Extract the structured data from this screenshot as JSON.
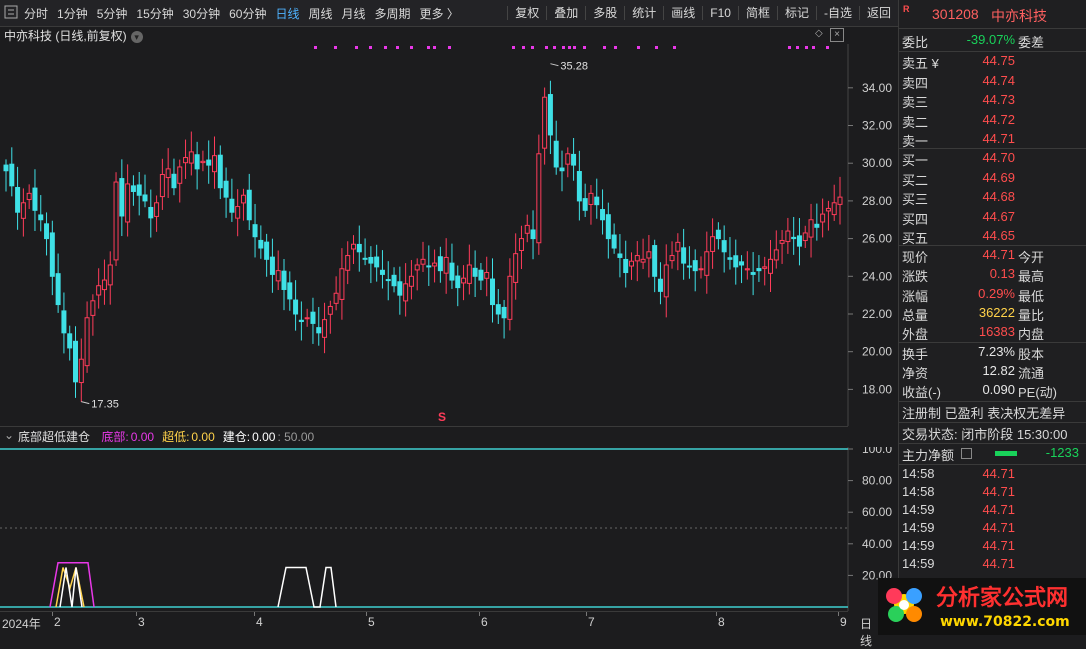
{
  "toolbar": {
    "period_tabs": [
      "分时",
      "1分钟",
      "5分钟",
      "15分钟",
      "30分钟",
      "60分钟",
      "日线",
      "周线",
      "月线",
      "多周期",
      "更多 〉"
    ],
    "active_tab": "日线",
    "tools": [
      "复权",
      "叠加",
      "多股",
      "统计",
      "画线",
      "F10",
      "简框",
      "标记",
      "-自选",
      "返回"
    ]
  },
  "chart": {
    "title": "中亦科技 (日线,前复权)",
    "high_label": "35.28",
    "low_label": "17.35",
    "signal_mark": "S",
    "price_ticks": [
      "34.00",
      "32.00",
      "30.00",
      "28.00",
      "26.00",
      "24.00",
      "22.00",
      "20.00",
      "18.00"
    ],
    "colors": {
      "up": "#ff3c5a",
      "down": "#3fe0e6",
      "magenta": "#e838e8"
    }
  },
  "indicator": {
    "name": "底部超低建仓",
    "items": [
      {
        "label": "底部:",
        "value": "0.00",
        "color": "#e838e8"
      },
      {
        "label": "超低:",
        "value": "0.00",
        "color": "#ffd24a"
      },
      {
        "label": "建仓:",
        "value": "0.00",
        "color": "#ffffff"
      }
    ],
    "ref_level": ": 50.00",
    "axis": [
      "100.0",
      "80.00",
      "60.00",
      "40.00",
      "20.00"
    ]
  },
  "xaxis": {
    "labels": [
      "2024年",
      "2",
      "3",
      "4",
      "5",
      "6",
      "7",
      "8",
      "9",
      "日线"
    ]
  },
  "quote": {
    "code": "301208",
    "name": "中亦科技",
    "wei_bi": {
      "label": "委比",
      "value": "-39.07%",
      "tail": "委差"
    },
    "asks": [
      {
        "label": "卖五 ¥",
        "price": "44.75"
      },
      {
        "label": "卖四",
        "price": "44.74"
      },
      {
        "label": "卖三",
        "price": "44.73"
      },
      {
        "label": "卖二",
        "price": "44.72"
      },
      {
        "label": "卖一",
        "price": "44.71"
      }
    ],
    "bids": [
      {
        "label": "买一",
        "price": "44.70"
      },
      {
        "label": "买二",
        "price": "44.69"
      },
      {
        "label": "买三",
        "price": "44.68"
      },
      {
        "label": "买四",
        "price": "44.67"
      },
      {
        "label": "买五",
        "price": "44.65"
      }
    ],
    "stats1": [
      {
        "label": "现价",
        "value": "44.71",
        "tail": "今开",
        "color": "red"
      },
      {
        "label": "涨跌",
        "value": "0.13",
        "tail": "最高",
        "color": "red"
      },
      {
        "label": "涨幅",
        "value": "0.29%",
        "tail": "最低",
        "color": "red"
      },
      {
        "label": "总量",
        "value": "36222",
        "tail": "量比",
        "color": "yellow"
      },
      {
        "label": "外盘",
        "value": "16383",
        "tail": "内盘",
        "color": "red"
      }
    ],
    "stats2": [
      {
        "label": "换手",
        "value": "7.23%",
        "tail": "股本"
      },
      {
        "label": "净资",
        "value": "12.82",
        "tail": "流通"
      },
      {
        "label": "收益(-)",
        "value": "0.090",
        "tail": "PE(动)"
      }
    ],
    "info": "注册制 已盈利 表决权无差异",
    "status": "交易状态: 闭市阶段 15:30:00",
    "net_flow": {
      "label": "主力净额",
      "value": "-1233"
    },
    "ticks": [
      {
        "time": "14:58",
        "price": "44.71"
      },
      {
        "time": "14:58",
        "price": "44.71"
      },
      {
        "time": "14:59",
        "price": "44.71"
      },
      {
        "time": "14:59",
        "price": "44.71"
      },
      {
        "time": "14:59",
        "price": "44.71"
      },
      {
        "time": "14:59",
        "price": "44.71"
      }
    ]
  },
  "logo": {
    "text": "分析家公式网",
    "url": "www.70822.com"
  }
}
